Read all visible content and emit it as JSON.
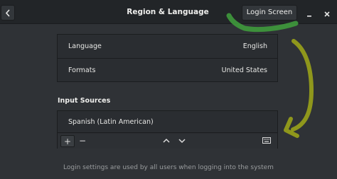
{
  "window": {
    "title": "Region & Language",
    "login_screen_label": "Login Screen"
  },
  "language_settings": [
    {
      "label": "Language",
      "value": "English"
    },
    {
      "label": "Formats",
      "value": "United States"
    }
  ],
  "input_sources": {
    "title": "Input Sources",
    "items": [
      "Spanish (Latin American)"
    ],
    "toolbar": {
      "add_label": "+",
      "remove_label": "−"
    }
  },
  "footer": {
    "text": "Login settings are used by all users when logging into the system"
  },
  "annotation_colors": {
    "green_scribble": "#3f9a3c",
    "olive_arrow": "#9aa21a"
  }
}
